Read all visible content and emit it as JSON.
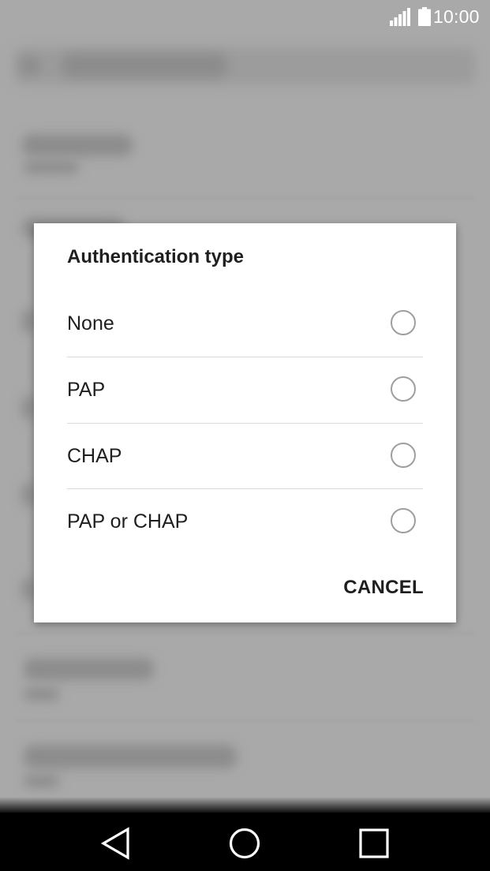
{
  "status_bar": {
    "time": "10:00",
    "signal_icon": "signal-icon",
    "battery_icon": "battery-icon"
  },
  "dialog": {
    "title": "Authentication type",
    "options": [
      {
        "label": "None",
        "selected": false
      },
      {
        "label": "PAP",
        "selected": false
      },
      {
        "label": "CHAP",
        "selected": false
      },
      {
        "label": "PAP or CHAP",
        "selected": false
      }
    ],
    "cancel_label": "CANCEL"
  },
  "nav_bar": {
    "back_icon": "back-icon",
    "home_icon": "home-icon",
    "recents_icon": "recents-icon"
  },
  "colors": {
    "scrim": "#a9a9a9",
    "dialog_bg": "#ffffff",
    "text": "#1f1f1f",
    "radio_border": "#9e9e9e",
    "nav_bg": "#000000"
  }
}
